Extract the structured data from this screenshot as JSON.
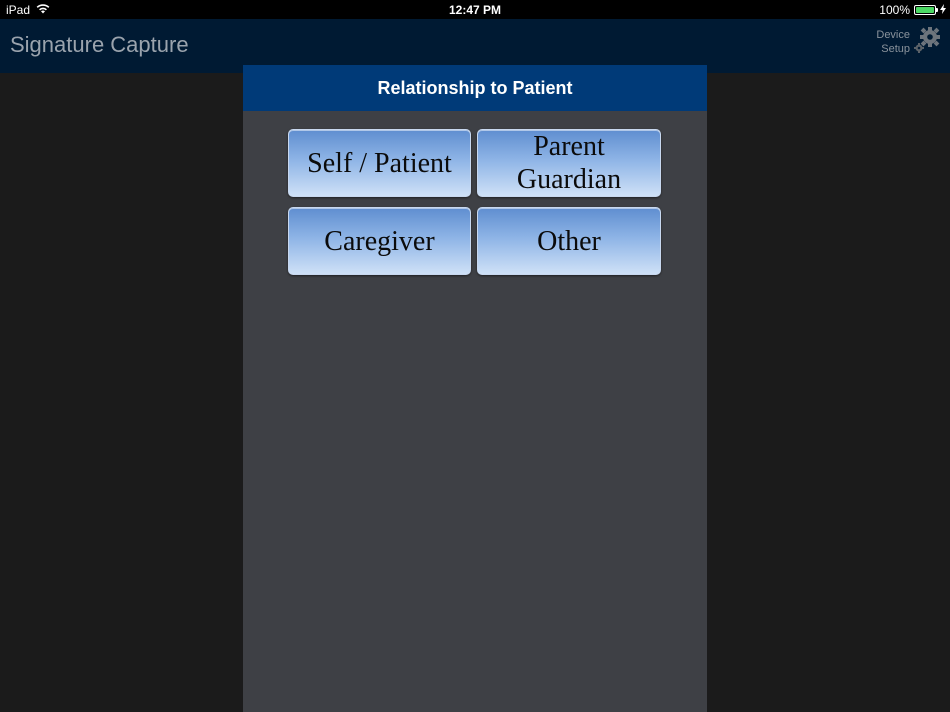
{
  "status_bar": {
    "device": "iPad",
    "time": "12:47 PM",
    "battery_text": "100%",
    "battery_level": 1.0,
    "battery_color": "#4cd964"
  },
  "nav": {
    "title": "Signature Capture",
    "device_setup_line1": "Device",
    "device_setup_line2": "Setup",
    "icons": [
      "wifi-icon",
      "battery-icon",
      "charging-icon",
      "gear-icon"
    ]
  },
  "modal": {
    "title": "Relationship to Patient",
    "header_color": "#003a78",
    "options": [
      {
        "line1": "Self / Patient",
        "line2": ""
      },
      {
        "line1": "Parent",
        "line2": "Guardian"
      },
      {
        "line1": "Caregiver",
        "line2": ""
      },
      {
        "line1": "Other",
        "line2": ""
      }
    ]
  }
}
